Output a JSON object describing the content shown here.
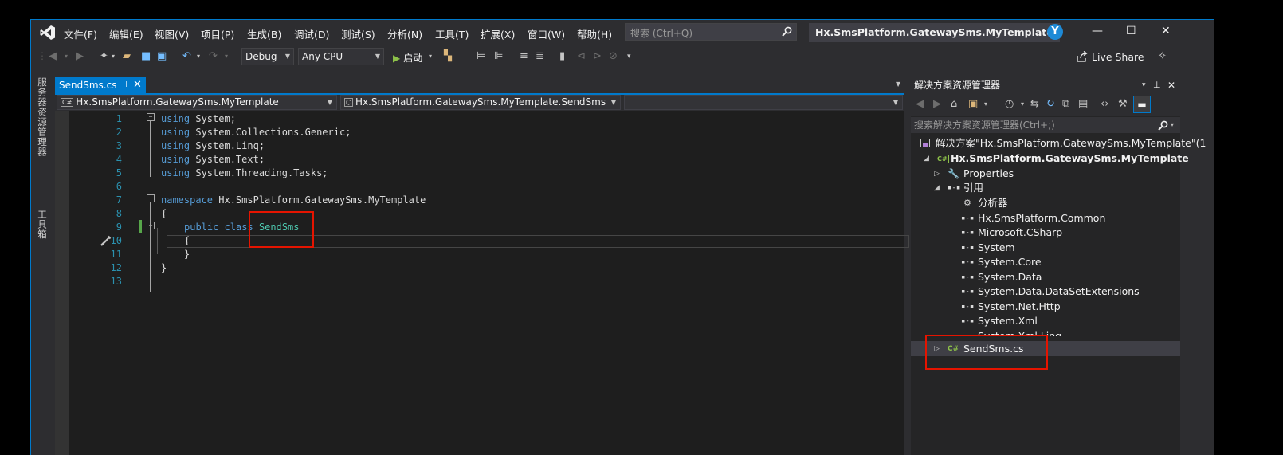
{
  "window": {
    "menu": [
      "文件(F)",
      "编辑(E)",
      "视图(V)",
      "项目(P)",
      "生成(B)",
      "调试(D)",
      "测试(S)",
      "分析(N)",
      "工具(T)",
      "扩展(X)",
      "窗口(W)",
      "帮助(H)"
    ],
    "search_placeholder": "搜索 (Ctrl+Q)",
    "solution_title": "Hx.SmsPlatform.GatewaySms.MyTemplate",
    "avatar_letter": "Y",
    "min": "—",
    "max": "☐",
    "close": "✕"
  },
  "toolbar": {
    "config": "Debug",
    "platform": "Any CPU",
    "start_label": "启动",
    "live_share": "Live Share"
  },
  "left_strip": {
    "server_explorer": "服务器资源管理器",
    "toolbox": "工具箱"
  },
  "doc_tab": {
    "label": "SendSms.cs",
    "pin": "⊣",
    "close": "✕"
  },
  "navbar": {
    "project": "Hx.SmsPlatform.GatewaySms.MyTemplate",
    "type": "Hx.SmsPlatform.GatewaySms.MyTemplate.SendSms",
    "member": ""
  },
  "editor": {
    "line_numbers": [
      "1",
      "2",
      "3",
      "4",
      "5",
      "6",
      "7",
      "8",
      "9",
      "10",
      "11",
      "12",
      "13"
    ],
    "lines": [
      {
        "kw": "using",
        "rest": " System;"
      },
      {
        "kw": "using",
        "rest": " System.Collections.Generic;"
      },
      {
        "kw": "using",
        "rest": " System.Linq;"
      },
      {
        "kw": "using",
        "rest": " System.Text;"
      },
      {
        "kw": "using",
        "rest": " System.Threading.Tasks;"
      },
      {
        "kw": "",
        "rest": ""
      },
      {
        "kw": "namespace",
        "rest": " Hx.SmsPlatform.GatewaySms.MyTemplate"
      },
      {
        "kw": "",
        "rest": "{"
      },
      {
        "kw": "public class",
        "rest": " ",
        "type": "SendSms"
      },
      {
        "kw": "",
        "rest": "{"
      },
      {
        "kw": "",
        "rest": "}"
      },
      {
        "kw": "",
        "rest": "}"
      },
      {
        "kw": "",
        "rest": ""
      }
    ]
  },
  "solution_explorer": {
    "title": "解决方案资源管理器",
    "search_placeholder": "搜索解决方案资源管理器(Ctrl+;)",
    "solution_node": "解决方案\"Hx.SmsPlatform.GatewaySms.MyTemplate\"(1",
    "project_node": "Hx.SmsPlatform.GatewaySms.MyTemplate",
    "properties": "Properties",
    "references": "引用",
    "analyzers": "分析器",
    "reference_items": [
      "Hx.SmsPlatform.Common",
      "Microsoft.CSharp",
      "System",
      "System.Core",
      "System.Data",
      "System.Data.DataSetExtensions",
      "System.Net.Http",
      "System.Xml",
      "System.Xml.Linq"
    ],
    "file_node": "SendSms.cs"
  },
  "colors": {
    "accent": "#007acc",
    "keyword": "#569cd6",
    "type": "#4ec9b0",
    "highlight_box": "#e51400"
  }
}
